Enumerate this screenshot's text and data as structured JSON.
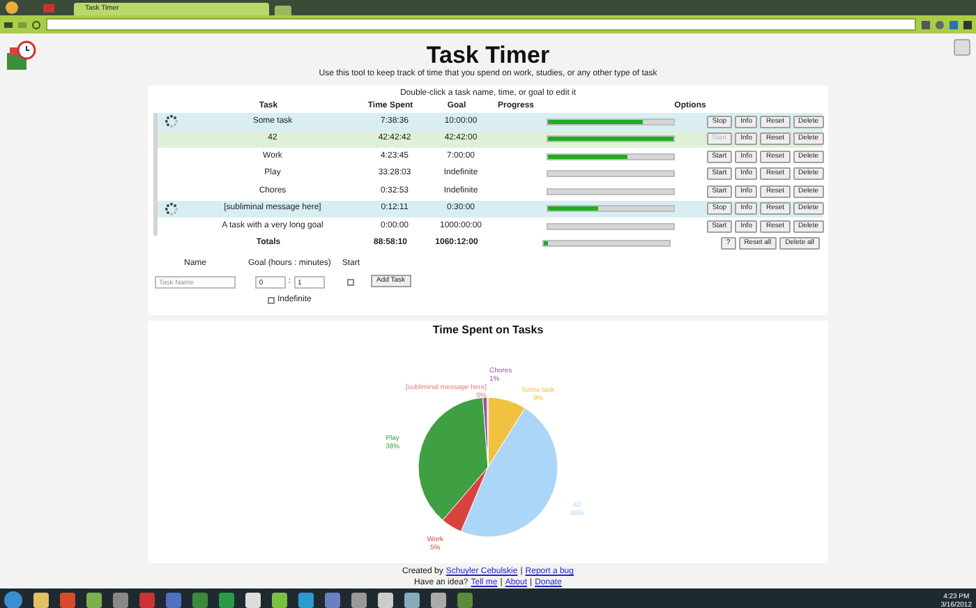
{
  "browser": {
    "tab_title": "Task Timer"
  },
  "header": {
    "title": "Task Timer",
    "subtitle": "Use this tool to keep track of time that you spend on work, studies, or any other type of task"
  },
  "table": {
    "hint": "Double-click a task name, time, or goal to edit it",
    "columns": [
      "Task",
      "Time Spent",
      "Goal",
      "Progress",
      "Options"
    ],
    "rows": [
      {
        "name": "Some task",
        "time": "7:38:36",
        "goal": "10:00:00",
        "level": 0.76,
        "running": true,
        "complete": false,
        "buttons": [
          {
            "label": "Stop",
            "disabled": false
          },
          {
            "label": "Info",
            "disabled": false
          },
          {
            "label": "Reset",
            "disabled": false
          },
          {
            "label": "Delete",
            "disabled": false
          }
        ]
      },
      {
        "name": "42",
        "time": "42:42:42",
        "goal": "42:42:00",
        "level": 1,
        "running": false,
        "complete": true,
        "buttons": [
          {
            "label": "Start",
            "disabled": true
          },
          {
            "label": "Info",
            "disabled": false
          },
          {
            "label": "Reset",
            "disabled": false
          },
          {
            "label": "Delete",
            "disabled": false
          }
        ]
      },
      {
        "name": "Work",
        "time": "4:23:45",
        "goal": "7:00:00",
        "level": 0.63,
        "running": false,
        "complete": false,
        "buttons": [
          {
            "label": "Start",
            "disabled": false
          },
          {
            "label": "Info",
            "disabled": false
          },
          {
            "label": "Reset",
            "disabled": false
          },
          {
            "label": "Delete",
            "disabled": false
          }
        ]
      },
      {
        "name": "Play",
        "time": "33:28:03",
        "goal": "Indefinite",
        "level": 0,
        "running": false,
        "complete": false,
        "buttons": [
          {
            "label": "Start",
            "disabled": false
          },
          {
            "label": "Info",
            "disabled": false
          },
          {
            "label": "Reset",
            "disabled": false
          },
          {
            "label": "Delete",
            "disabled": false
          }
        ]
      },
      {
        "name": "Chores",
        "time": "0:32:53",
        "goal": "Indefinite",
        "level": 0,
        "running": false,
        "complete": false,
        "buttons": [
          {
            "label": "Start",
            "disabled": false
          },
          {
            "label": "Info",
            "disabled": false
          },
          {
            "label": "Reset",
            "disabled": false
          },
          {
            "label": "Delete",
            "disabled": false
          }
        ]
      },
      {
        "name": "[subliminal message here]",
        "time": "0:12:11",
        "goal": "0:30:00",
        "level": 0.4,
        "running": true,
        "complete": false,
        "buttons": [
          {
            "label": "Stop",
            "disabled": false
          },
          {
            "label": "Info",
            "disabled": false
          },
          {
            "label": "Reset",
            "disabled": false
          },
          {
            "label": "Delete",
            "disabled": false
          }
        ]
      },
      {
        "name": "A task with a very long goal",
        "time": "0:00:00",
        "goal": "1000:00:00",
        "level": 0,
        "running": false,
        "complete": false,
        "buttons": [
          {
            "label": "Start",
            "disabled": false
          },
          {
            "label": "Info",
            "disabled": false
          },
          {
            "label": "Reset",
            "disabled": false
          },
          {
            "label": "Delete",
            "disabled": false
          }
        ]
      }
    ],
    "totals": {
      "label": "Totals",
      "time": "88:58:10",
      "goal": "1060:12:00",
      "level": 0.03,
      "buttons": [
        "?",
        "Reset all",
        "Delete all"
      ]
    }
  },
  "add_form": {
    "name_label": "Name",
    "goal_label": "Goal (hours : minutes)",
    "start_label": "Start",
    "name_placeholder": "Task Name",
    "hours": "0",
    "separator": ":",
    "minutes": "1",
    "indefinite_label": "Indefinite",
    "indefinite": false,
    "start": false,
    "button": "Add Task"
  },
  "chart": {
    "chart_data": {
      "type": "pie",
      "title": "Time Spent on Tasks",
      "categories": [
        "Some task",
        "42",
        "Work",
        "Play",
        "Chores",
        "[subliminal message here]"
      ],
      "values": [
        9,
        48,
        5,
        38,
        1,
        0.2
      ],
      "colors": [
        "#f0c23f",
        "#acd6f7",
        "#d9433f",
        "#3f9f43",
        "#9a4fa6",
        "#e8787a"
      ],
      "value_labels": [
        "9%",
        "48%",
        "5%",
        "38%",
        "1%",
        "0%"
      ]
    }
  },
  "footer": {
    "created_by": "Created by",
    "author": "Schuyler Cebulskie",
    "report": "Report a bug",
    "idea": "Have an idea?",
    "tell": "Tell me",
    "about": "About",
    "donate": "Donate",
    "separators": [
      "|",
      "|",
      "|"
    ]
  },
  "taskbar": {
    "time": "4:23 PM",
    "date": "3/16/2012"
  }
}
